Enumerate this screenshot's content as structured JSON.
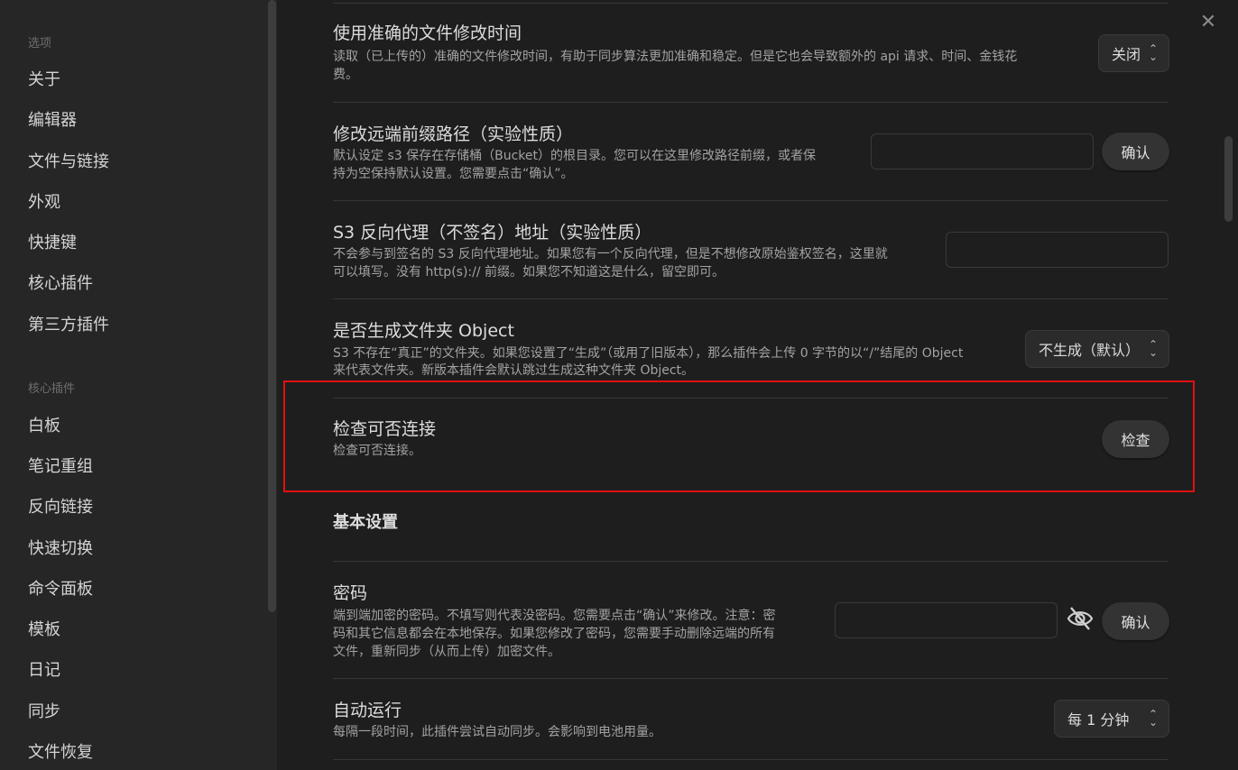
{
  "sidebar": {
    "sections": [
      {
        "heading": "选项",
        "items": [
          "关于",
          "编辑器",
          "文件与链接",
          "外观",
          "快捷键",
          "核心插件",
          "第三方插件"
        ]
      },
      {
        "heading": "核心插件",
        "items": [
          "白板",
          "笔记重组",
          "反向链接",
          "快速切换",
          "命令面板",
          "模板",
          "日记",
          "同步",
          "文件恢复"
        ]
      }
    ]
  },
  "close": {
    "icon": "close-icon"
  },
  "settings": {
    "accurate_mtime": {
      "title": "使用准确的文件修改时间",
      "desc_line1": "读取（已上传的）准确的文件修改时间，有助于同步算法更加准确和稳定。但是它也会导致额外的 api 请求、时间、金钱花",
      "desc_line2": "费。",
      "value": "关闭"
    },
    "remote_prefix": {
      "title": "修改远端前缀路径（实验性质）",
      "desc_line1": "默认设定 s3 保存在存储桶（Bucket）的根目录。您可以在这里修改路径前缀，或者保",
      "desc_line2": "持为空保持默认设置。您需要点击“确认”。",
      "input_value": "",
      "button": "确认"
    },
    "reverse_proxy": {
      "title": "S3 反向代理（不签名）地址（实验性质）",
      "desc_line1": "不会参与到签名的 S3 反向代理地址。如果您有一个反向代理，但是不想修改原始鉴权签名，这里就",
      "desc_line2": "可以填写。没有 http(s):// 前缀。如果您不知道这是什么，留空即可。",
      "input_value": ""
    },
    "folder_object": {
      "title": "是否生成文件夹 Object",
      "desc_line1": "S3 不存在“真正”的文件夹。如果您设置了“生成”（或用了旧版本），那么插件会上传 0 字节的以“/”结尾的 Object",
      "desc_line2": "来代表文件夹。新版本插件会默认跳过生成这种文件夹 Object。",
      "value": "不生成（默认）"
    },
    "check_connection": {
      "title": "检查可否连接",
      "desc": "检查可否连接。",
      "button": "检查"
    },
    "basic_heading": "基本设置",
    "password": {
      "title": "密码",
      "desc_line1": "端到端加密的密码。不填写则代表没密码。您需要点击“确认”来修改。注意：密",
      "desc_line2": "码和其它信息都会在本地保存。如果您修改了密码，您需要手动删除远端的所有",
      "desc_line3": "文件，重新同步（从而上传）加密文件。",
      "input_value": "",
      "button": "确认"
    },
    "auto_run": {
      "title": "自动运行",
      "desc": "每隔一段时间，此插件尝试自动同步。会影响到电池用量。",
      "value": "每 1 分钟"
    }
  },
  "colors": {
    "highlight": "#e01010",
    "sidebar_bg": "#262626",
    "content_bg": "#1e1e1e"
  }
}
